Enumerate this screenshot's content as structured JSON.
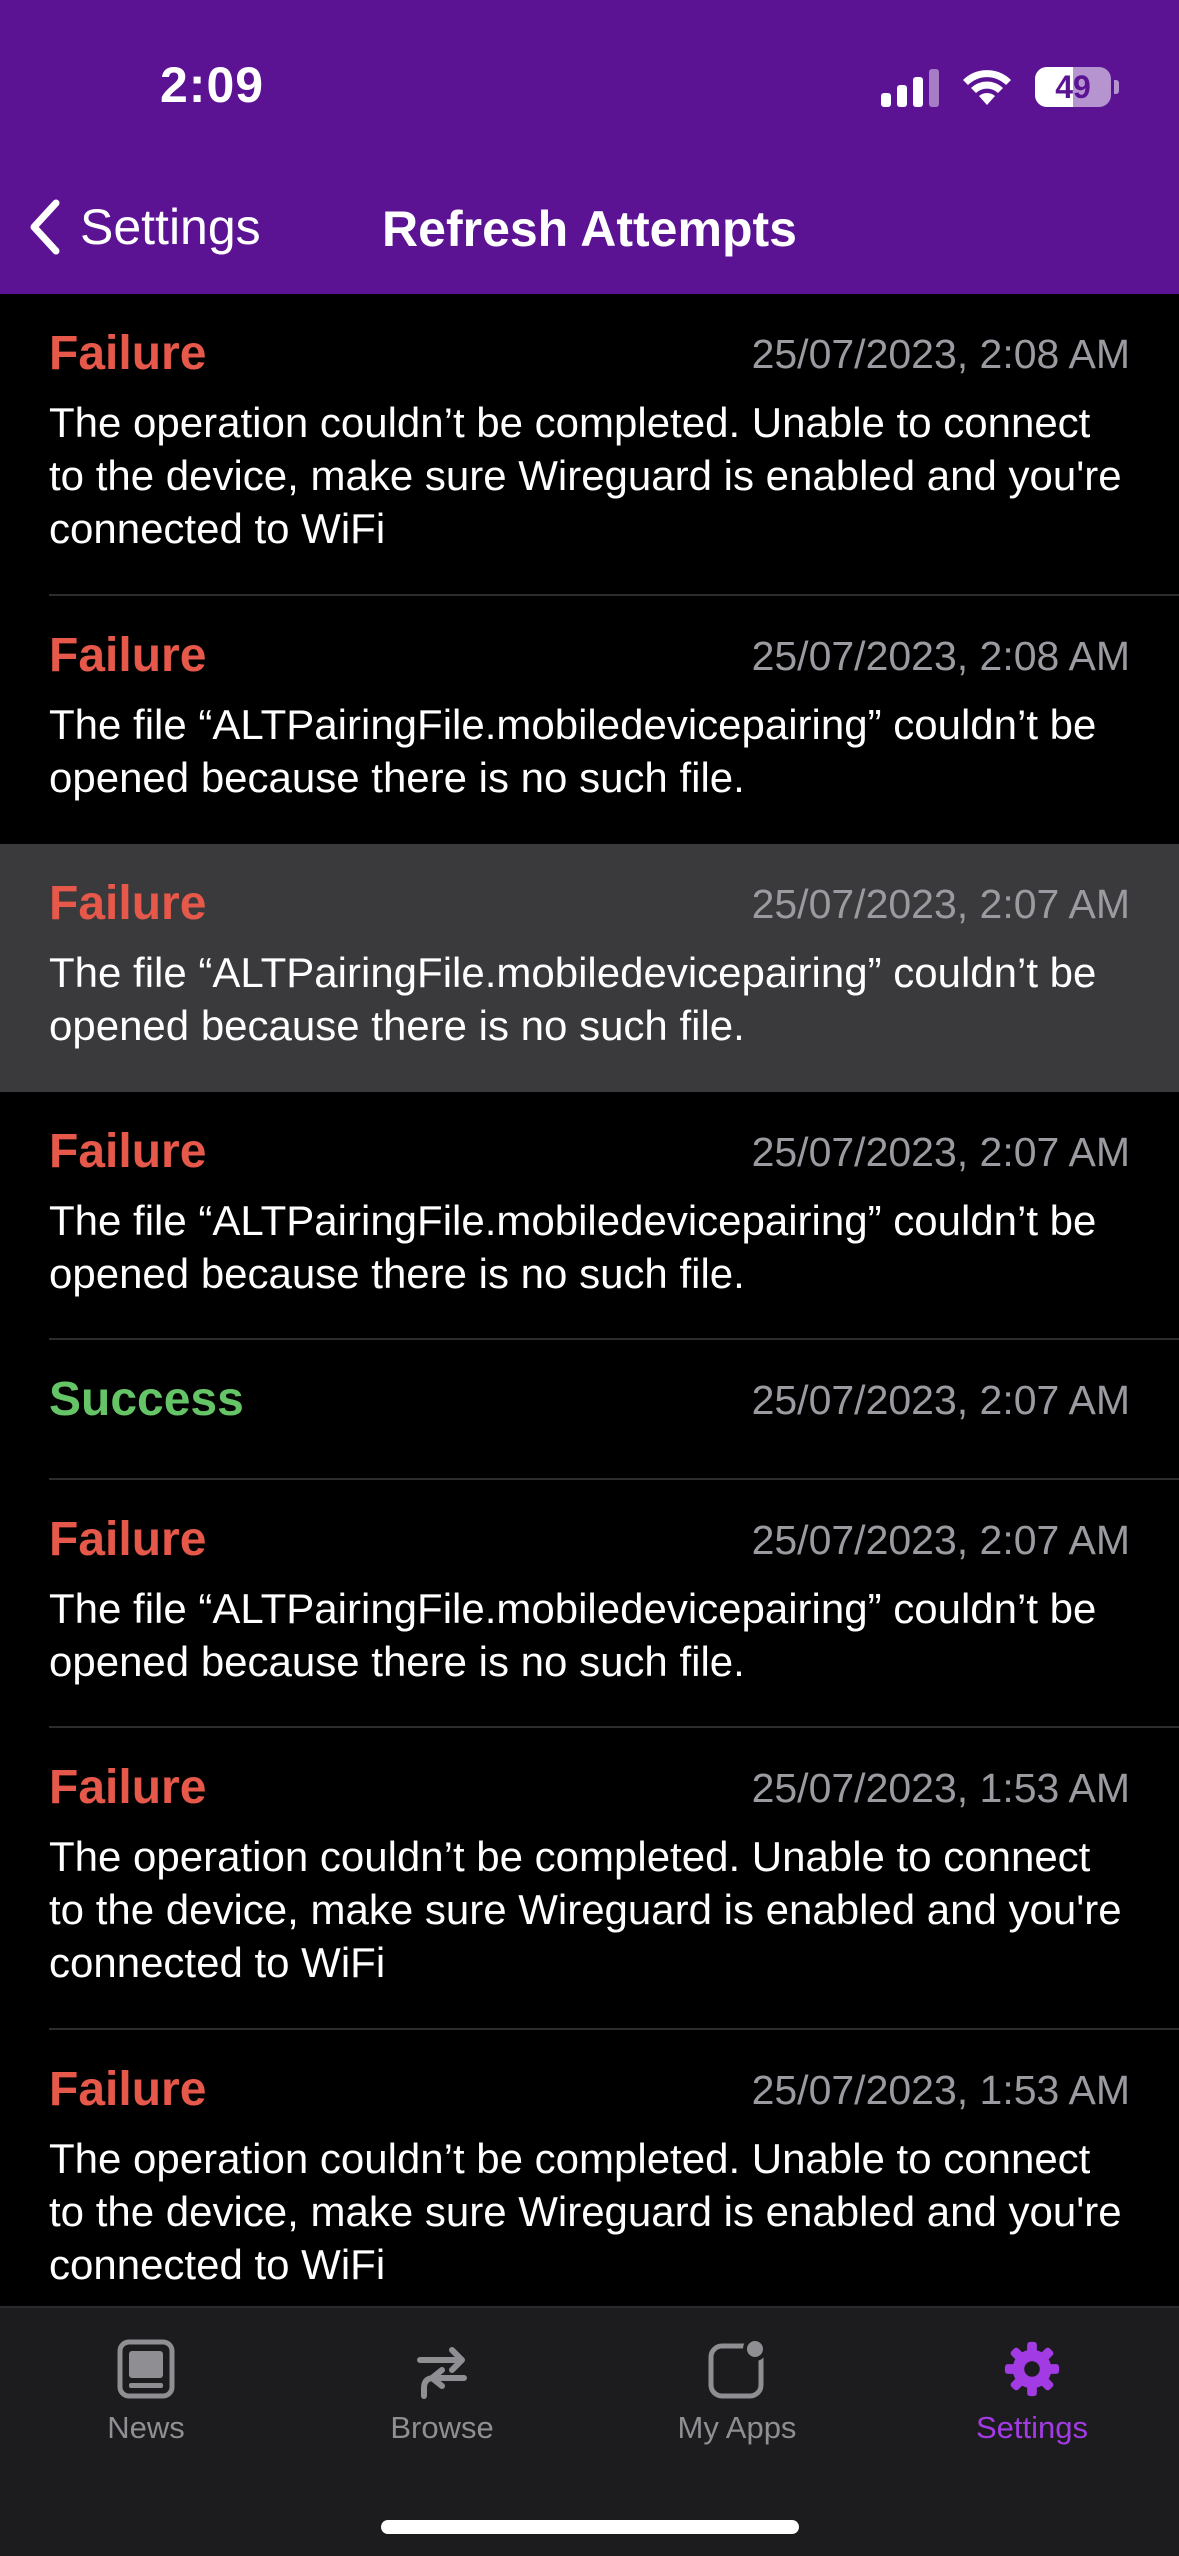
{
  "status_bar": {
    "time": "2:09",
    "battery": "49"
  },
  "nav": {
    "back_label": "Settings",
    "title": "Refresh Attempts"
  },
  "attempts": [
    {
      "status": "Failure",
      "date": "25/07/2023, 2:08 AM",
      "message": "The operation couldn’t be completed. Unable to connect to the device, make sure Wireguard is enabled and you're connected to WiFi"
    },
    {
      "status": "Failure",
      "date": "25/07/2023, 2:08 AM",
      "message": "The file “ALTPairingFile.mobiledevicepairing” couldn’t be opened because there is no such file."
    },
    {
      "status": "Failure",
      "date": "25/07/2023, 2:07 AM",
      "message": "The file “ALTPairingFile.mobiledevicepairing” couldn’t be opened because there is no such file."
    },
    {
      "status": "Failure",
      "date": "25/07/2023, 2:07 AM",
      "message": "The file “ALTPairingFile.mobiledevicepairing” couldn’t be opened because there is no such file."
    },
    {
      "status": "Success",
      "date": "25/07/2023, 2:07 AM",
      "message": ""
    },
    {
      "status": "Failure",
      "date": "25/07/2023, 2:07 AM",
      "message": "The file “ALTPairingFile.mobiledevicepairing” couldn’t be opened because there is no such file."
    },
    {
      "status": "Failure",
      "date": "25/07/2023, 1:53 AM",
      "message": "The operation couldn’t be completed. Unable to connect to the device, make sure Wireguard is enabled and you're connected to WiFi"
    },
    {
      "status": "Failure",
      "date": "25/07/2023, 1:53 AM",
      "message": "The operation couldn’t be completed. Unable to connect to the device, make sure Wireguard is enabled and you're connected to WiFi"
    }
  ],
  "tabs": [
    {
      "label": "News",
      "icon": "news-icon"
    },
    {
      "label": "Browse",
      "icon": "browse-icon"
    },
    {
      "label": "My Apps",
      "icon": "my-apps-icon"
    },
    {
      "label": "Settings",
      "icon": "gear-icon"
    }
  ],
  "colors": {
    "header": "#5b1394",
    "failure": "#e5584a",
    "success": "#64c466",
    "tab_active": "#a33be4"
  }
}
